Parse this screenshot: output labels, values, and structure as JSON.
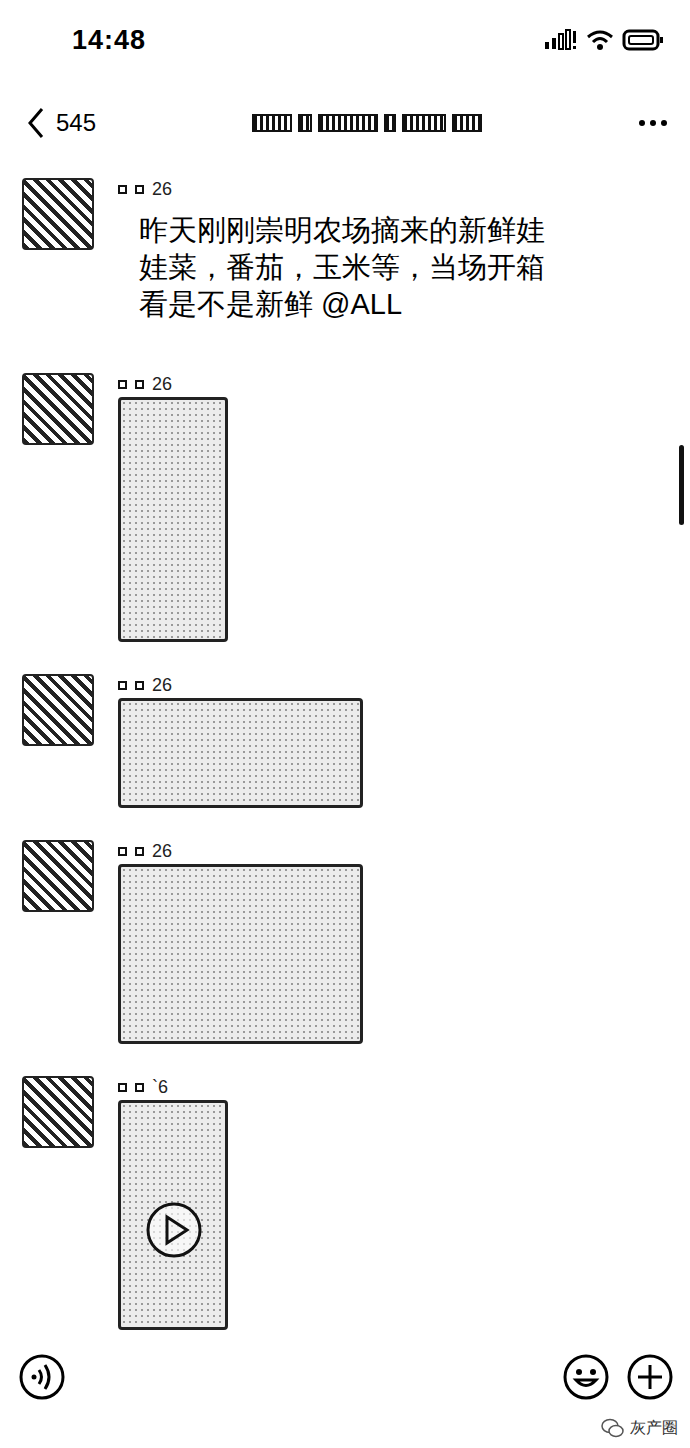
{
  "status_bar": {
    "time": "14:48"
  },
  "header": {
    "count": "545"
  },
  "messages": [
    {
      "kind": "text",
      "sender": "26",
      "text": "昨天刚刚崇明农场摘来的新鲜娃娃菜，番茄，玉米等，当场开箱看是不是新鲜 @ALL"
    },
    {
      "kind": "photo-tall",
      "sender": "26"
    },
    {
      "kind": "photo-wide",
      "sender": "26"
    },
    {
      "kind": "photo-box",
      "sender": "26"
    },
    {
      "kind": "video",
      "sender": "`6"
    }
  ],
  "watermark": {
    "text": "灰产圈"
  }
}
